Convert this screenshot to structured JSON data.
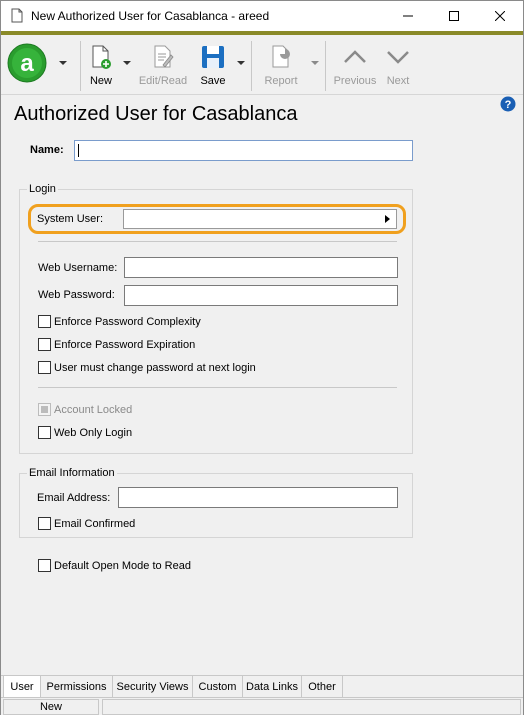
{
  "window": {
    "title": "New Authorized User for Casablanca - areed"
  },
  "toolbar": {
    "new_label": "New",
    "editread_label": "Edit/Read",
    "save_label": "Save",
    "report_label": "Report",
    "previous_label": "Previous",
    "next_label": "Next"
  },
  "form": {
    "title": "Authorized User for Casablanca",
    "name_label": "Name:",
    "name_value": ""
  },
  "login": {
    "group_label": "Login",
    "system_user_label": "System User:",
    "system_user_value": "",
    "web_username_label": "Web Username:",
    "web_username_value": "",
    "web_password_label": "Web Password:",
    "web_password_value": "",
    "enforce_complexity": "Enforce Password Complexity",
    "enforce_expiration": "Enforce Password Expiration",
    "must_change": "User must change password at next login",
    "account_locked": "Account Locked",
    "web_only": "Web Only Login"
  },
  "email": {
    "group_label": "Email Information",
    "address_label": "Email Address:",
    "address_value": "",
    "confirmed": "Email Confirmed"
  },
  "default_open_mode": "Default Open Mode to Read",
  "tabs": [
    {
      "label": "User"
    },
    {
      "label": "Permissions"
    },
    {
      "label": "Security Views"
    },
    {
      "label": "Custom"
    },
    {
      "label": "Data Links"
    },
    {
      "label": "Other"
    }
  ],
  "status": {
    "mode": "New"
  },
  "colors": {
    "accent": "#8a8a28",
    "highlight": "#f0a01e",
    "logo_green": "#2a9d2e",
    "save_blue": "#1c6fc1",
    "help_blue": "#1a5fb4"
  }
}
